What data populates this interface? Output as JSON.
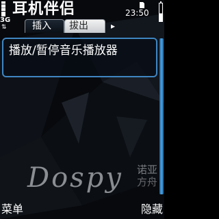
{
  "status_bar": {
    "network": "3G",
    "network_arrows": "⇅",
    "clock": "23:50",
    "battery_level": 0.45
  },
  "header": {
    "title": "耳机伴侣"
  },
  "tabs": [
    {
      "label": "插入",
      "active": true
    },
    {
      "label": "拔出",
      "active": false
    }
  ],
  "tab_scroll_arrow": "▸",
  "list": {
    "items": [
      {
        "label": "播放/暂停音乐播放器",
        "selected": true
      }
    ]
  },
  "watermark": {
    "logo": "Dospy",
    "sub_line1": "诺亚",
    "sub_line2": "方舟"
  },
  "softkeys": {
    "left": "菜单",
    "right": "隐藏"
  },
  "colors": {
    "highlight_border": "#3f86c2",
    "scrollbar": "#4da3e0",
    "background": "#07090d"
  }
}
